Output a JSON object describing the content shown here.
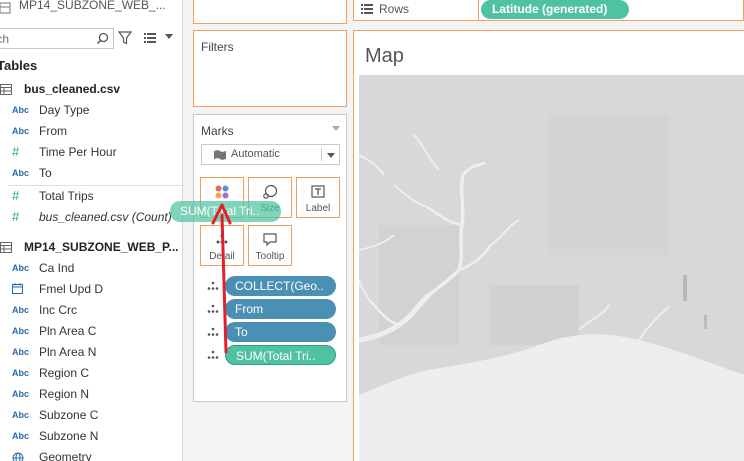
{
  "data_pane": {
    "datasource_name": "MP14_SUBZONE_WEB_...",
    "search_placeholder": "Search",
    "tables_label": "Tables",
    "tables": [
      {
        "name": "bus_cleaned.csv",
        "fields": [
          {
            "type": "Abc",
            "name": "Day Type"
          },
          {
            "type": "Abc",
            "name": "From"
          },
          {
            "type": "#",
            "name": "Time Per Hour"
          },
          {
            "type": "Abc",
            "name": "To"
          },
          {
            "type": "#",
            "name": "Total Trips"
          },
          {
            "type": "#",
            "name": "bus_cleaned.csv (Count)"
          }
        ]
      },
      {
        "name": "MP14_SUBZONE_WEB_P...",
        "fields": [
          {
            "type": "Abc",
            "name": "Ca Ind"
          },
          {
            "type": "date",
            "name": "Fmel Upd D"
          },
          {
            "type": "Abc",
            "name": "Inc Crc"
          },
          {
            "type": "Abc",
            "name": "Pln Area C"
          },
          {
            "type": "Abc",
            "name": "Pln Area N"
          },
          {
            "type": "Abc",
            "name": "Region C"
          },
          {
            "type": "Abc",
            "name": "Region N"
          },
          {
            "type": "Abc",
            "name": "Subzone C"
          },
          {
            "type": "Abc",
            "name": "Subzone N"
          },
          {
            "type": "geo",
            "name": "Geometry"
          }
        ]
      }
    ]
  },
  "filters": {
    "title": "Filters"
  },
  "marks": {
    "title": "Marks",
    "mark_type": "Automatic",
    "buttons": {
      "color": "",
      "size": "Size",
      "label": "Label",
      "detail": "Detail",
      "tooltip": "Tooltip"
    },
    "pills": [
      "COLLECT(Geo..",
      "From",
      "To",
      "SUM(Total Tri.."
    ]
  },
  "drag_pill": "SUM(Total Tri..",
  "rows_shelf": {
    "label": "Rows",
    "pill": "Latitude (generated)"
  },
  "sheet": {
    "title": "Map"
  },
  "colors": {
    "accent_border": "#f0a060",
    "dimension_pill": "#4a90b5",
    "measure_pill": "#4fc3a1",
    "drag_arrow": "#e0202a"
  }
}
